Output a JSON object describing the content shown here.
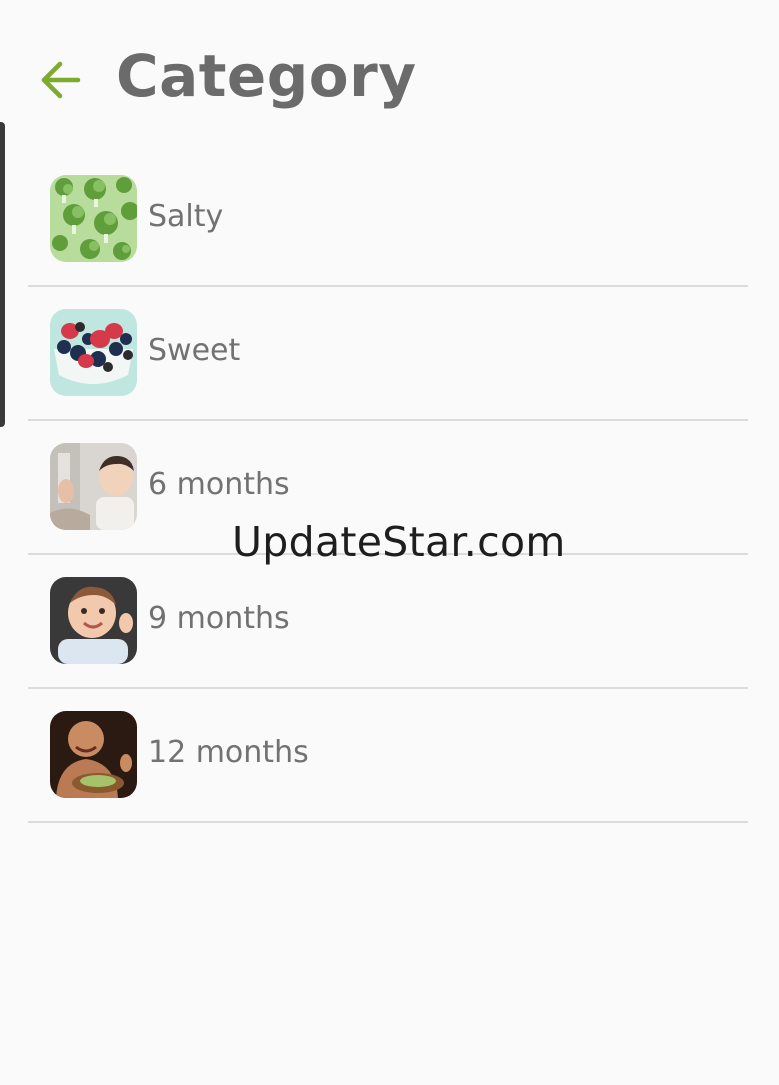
{
  "header": {
    "title": "Category",
    "back_icon": "arrow-left-icon",
    "accent_color": "#7cab2e"
  },
  "categories": [
    {
      "label": "Salty",
      "thumbnail": "broccoli-image"
    },
    {
      "label": "Sweet",
      "thumbnail": "berries-bowl-image"
    },
    {
      "label": "6 months",
      "thumbnail": "baby-6-months-image"
    },
    {
      "label": "9 months",
      "thumbnail": "baby-9-months-image"
    },
    {
      "label": "12 months",
      "thumbnail": "baby-12-months-image"
    }
  ],
  "watermark": "UpdateStar.com"
}
